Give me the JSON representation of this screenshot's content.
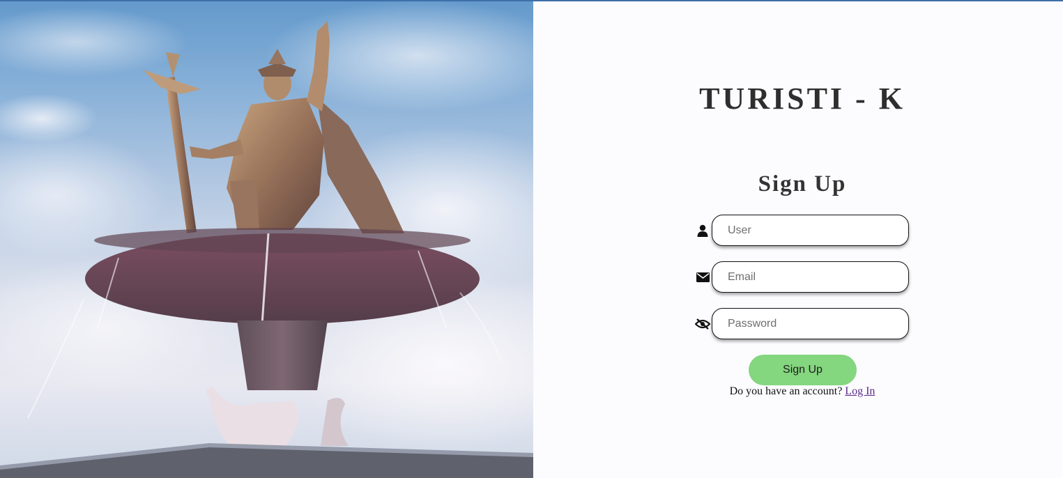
{
  "brand": {
    "title": "TURISTI - K"
  },
  "hero": {
    "image_alt": "statue-fountain-photo"
  },
  "form": {
    "title": "Sign Up",
    "user": {
      "placeholder": "User",
      "value": "",
      "icon": "user-icon"
    },
    "email": {
      "placeholder": "Email",
      "value": "",
      "icon": "envelope-icon"
    },
    "password": {
      "placeholder": "Password",
      "value": "",
      "icon": "eye-slash-icon"
    },
    "submit_label": "Sign Up",
    "login_prompt": "Do you have an account?",
    "login_link": "Log In"
  },
  "colors": {
    "accent_button": "#84d67f",
    "link": "#5b2a86",
    "top_border": "#3f6fa8"
  }
}
